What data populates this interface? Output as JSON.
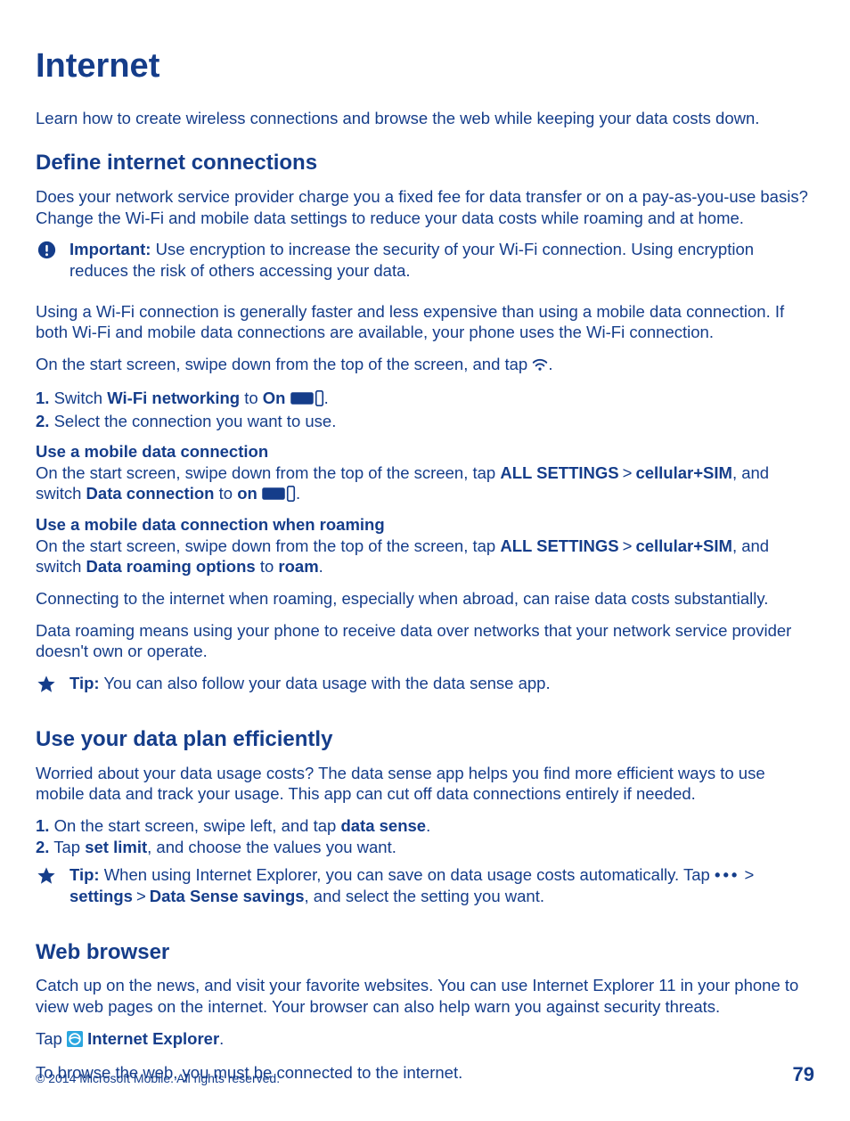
{
  "title": "Internet",
  "intro": "Learn how to create wireless connections and browse the web while keeping your data costs down.",
  "section1": {
    "heading": "Define internet connections",
    "para1": "Does your network service provider charge you a fixed fee for data transfer or on a pay-as-you-use basis? Change the Wi-Fi and mobile data settings to reduce your data costs while roaming and at home.",
    "important_label": "Important:",
    "important_text": " Use encryption to increase the security of your Wi-Fi connection. Using encryption reduces the risk of others accessing your data.",
    "para2": "Using a Wi-Fi connection is generally faster and less expensive than using a mobile data connection. If both Wi-Fi and mobile data connections are available, your phone uses the Wi-Fi connection.",
    "start_pre": "On the start screen, swipe down from the top of the screen, and tap ",
    "start_post": ".",
    "step1_num": "1.",
    "step1_a": " Switch ",
    "step1_b": "Wi-Fi networking",
    "step1_c": " to ",
    "step1_d": "On",
    "step1_e": " ",
    "step1_f": ".",
    "step2_num": "2.",
    "step2_text": " Select the connection you want to use.",
    "sub1": "Use a mobile data connection",
    "sub1_a": "On the start screen, swipe down from the top of the screen, tap ",
    "sub1_b": "ALL SETTINGS",
    "sub1_c": "cellular+SIM",
    "sub1_d": ", and switch ",
    "sub1_e": "Data connection",
    "sub1_f": " to ",
    "sub1_g": "on",
    "sub1_h": " ",
    "sub1_i": ".",
    "sub2": "Use a mobile data connection when roaming",
    "sub2_a": "On the start screen, swipe down from the top of the screen, tap ",
    "sub2_b": "ALL SETTINGS",
    "sub2_c": "cellular+SIM",
    "sub2_d": ", and switch ",
    "sub2_e": "Data roaming options",
    "sub2_f": " to ",
    "sub2_g": "roam",
    "sub2_h": ".",
    "para3": "Connecting to the internet when roaming, especially when abroad, can raise data costs substantially.",
    "para4": "Data roaming means using your phone to receive data over networks that your network service provider doesn't own or operate.",
    "tip_label": "Tip:",
    "tip_text": " You can also follow your data usage with the data sense app."
  },
  "section2": {
    "heading": "Use your data plan efficiently",
    "para1": "Worried about your data usage costs? The data sense app helps you find more efficient ways to use mobile data and track your usage. This app can cut off data connections entirely if needed.",
    "step1_num": "1.",
    "step1_a": " On the start screen, swipe left, and tap ",
    "step1_b": "data sense",
    "step1_c": ".",
    "step2_num": "2.",
    "step2_a": " Tap ",
    "step2_b": "set limit",
    "step2_c": ", and choose the values you want.",
    "tip_label": "Tip:",
    "tip_a": " When using Internet Explorer, you can save on data usage costs automatically. Tap ",
    "tip_b": "  > ",
    "tip_c": "settings",
    "tip_d": "Data Sense savings",
    "tip_e": ", and select the setting you want."
  },
  "section3": {
    "heading": "Web browser",
    "para1": "Catch up on the news, and visit your favorite websites. You can use Internet Explorer 11 in your phone to view web pages on the internet. Your browser can also help warn you against security threats.",
    "tap_a": "Tap ",
    "tap_b": "Internet Explorer",
    "tap_c": ".",
    "para2": "To browse the web, you must be connected to the internet."
  },
  "footer": {
    "copyright": "© 2014 Microsoft Mobile. All rights reserved.",
    "page": "79"
  },
  "glyphs": {
    "chevron": ">",
    "dots": "•••"
  }
}
